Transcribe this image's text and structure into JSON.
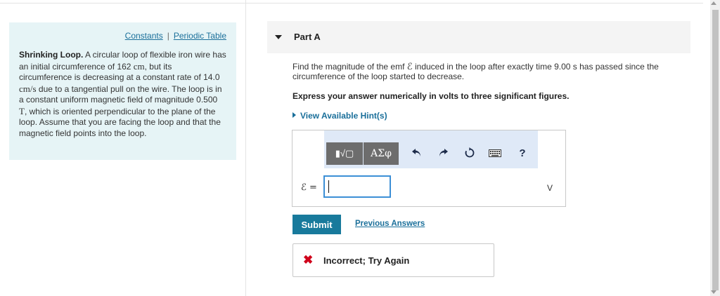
{
  "sidebar": {
    "links": {
      "constants": "Constants",
      "separator": "|",
      "periodic_table": "Periodic Table"
    },
    "problem": {
      "title": "Shrinking Loop.",
      "text_1": " A circular loop of flexible iron wire has an initial circumference of 162 ",
      "unit_cm": "cm",
      "text_2": ", but its circumference is decreasing at a constant rate of 14.0 ",
      "unit_rate": "cm/s",
      "text_3": " due to a tangential pull on the wire. The loop is in a constant uniform magnetic field of magnitude 0.500 ",
      "unit_t": "T",
      "text_4": ", which is oriented perpendicular to the plane of the loop. Assume that you are facing the loop and that the magnetic field points into the loop."
    }
  },
  "part": {
    "title": "Part A",
    "question_1": "Find the magnitude of the emf ",
    "emf_symbol": "ℰ",
    "question_2": " induced in the loop after exactly time 9.00 s has passed since the circumference of the loop started to decrease.",
    "instruction": "Express your answer numerically in volts to three significant figures.",
    "hints_label": "View Available Hint(s)"
  },
  "answer": {
    "toolbar": {
      "templates_label": "▮√▢",
      "greek_label": "ΑΣφ",
      "undo": "undo-icon",
      "redo": "redo-icon",
      "reset": "reset-icon",
      "keyboard": "keyboard-icon",
      "help_label": "?"
    },
    "variable_label": "ℰ =",
    "input_value": "",
    "unit": "V"
  },
  "actions": {
    "submit_label": "Submit",
    "previous_answers_label": "Previous Answers"
  },
  "feedback": {
    "icon": "✖",
    "text": "Incorrect; Try Again",
    "color": "#d0021b"
  },
  "colors": {
    "accent": "#187a9c",
    "link": "#1a6f9a",
    "sidebar_bg": "#e6f4f6"
  }
}
